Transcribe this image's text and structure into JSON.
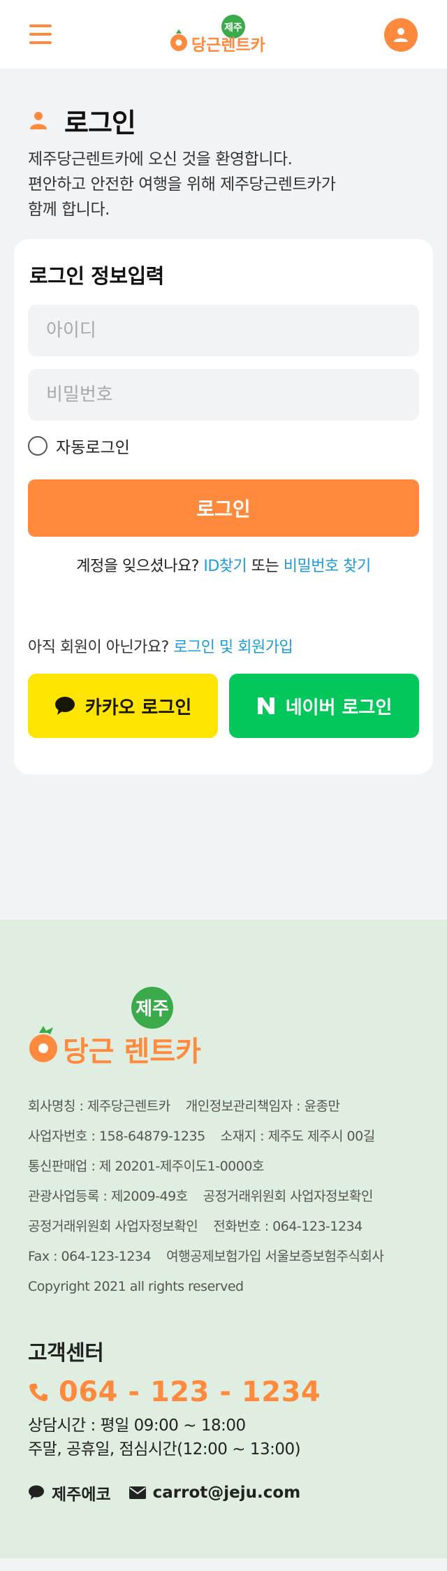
{
  "header": {
    "logo_badge": "제주",
    "logo_text": "당근렌트카"
  },
  "intro": {
    "title": "로그인",
    "welcome_lines": [
      "제주당근렌트카에 오신 것을 환영합니다.",
      "편안하고 안전한 여행을 위해 제주당근렌트카가",
      "함께 합니다."
    ]
  },
  "login_card": {
    "title": "로그인 정보입력",
    "id_placeholder": "아이디",
    "password_placeholder": "비밀번호",
    "auto_login_label": "자동로그인",
    "login_button": "로그인",
    "forgot_prefix": "계정을 잊으셨나요?",
    "find_id": "ID찾기",
    "or_text": "또는",
    "find_password": "비밀번호 찾기",
    "signup_prefix": "아직 회원이 아닌가요?",
    "signup_link": "로그인 및 회원가입",
    "kakao_button": "카카오 로그인",
    "naver_button": "네이버 로그인"
  },
  "footer": {
    "logo_badge": "제주",
    "logo_text": "당근 렌트카",
    "company_lines": [
      [
        "회사명칭 : 제주당근렌트카",
        "개인정보관리책임자 : 윤종만"
      ],
      [
        "사업자번호 : 158-64879-1235",
        "소재지 : 제주도 제주시 00길"
      ],
      [
        "통신판매업 : 제 20201-제주이도1-0000호"
      ],
      [
        "관광사업등록 : 제2009-49호",
        "공정거래위원회 사업자정보확인"
      ],
      [
        "공정거래위원회 사업자정보확인",
        "전화번호 : 064-123-1234"
      ],
      [
        "Fax : 064-123-1234",
        "여행공제보험가입 서울보증보험주식회사"
      ],
      [
        "Copyright 2021 all rights reserved"
      ]
    ],
    "cs_title": "고객센터",
    "phone": "064 - 123 - 1234",
    "hours_lines": [
      "상담시간 : 평일 09:00 ~ 18:00",
      "주말, 공휴일, 점심시간(12:00 ~ 13:00)"
    ],
    "chat_label": "제주에코",
    "email": "carrot@jeju.com"
  },
  "colors": {
    "accent": "#ff8a3d",
    "link": "#1a9ddb",
    "kakao": "#fee500",
    "naver": "#03c75a",
    "footer_bg": "#dfeee0",
    "page_bg": "#f2f3f5"
  }
}
